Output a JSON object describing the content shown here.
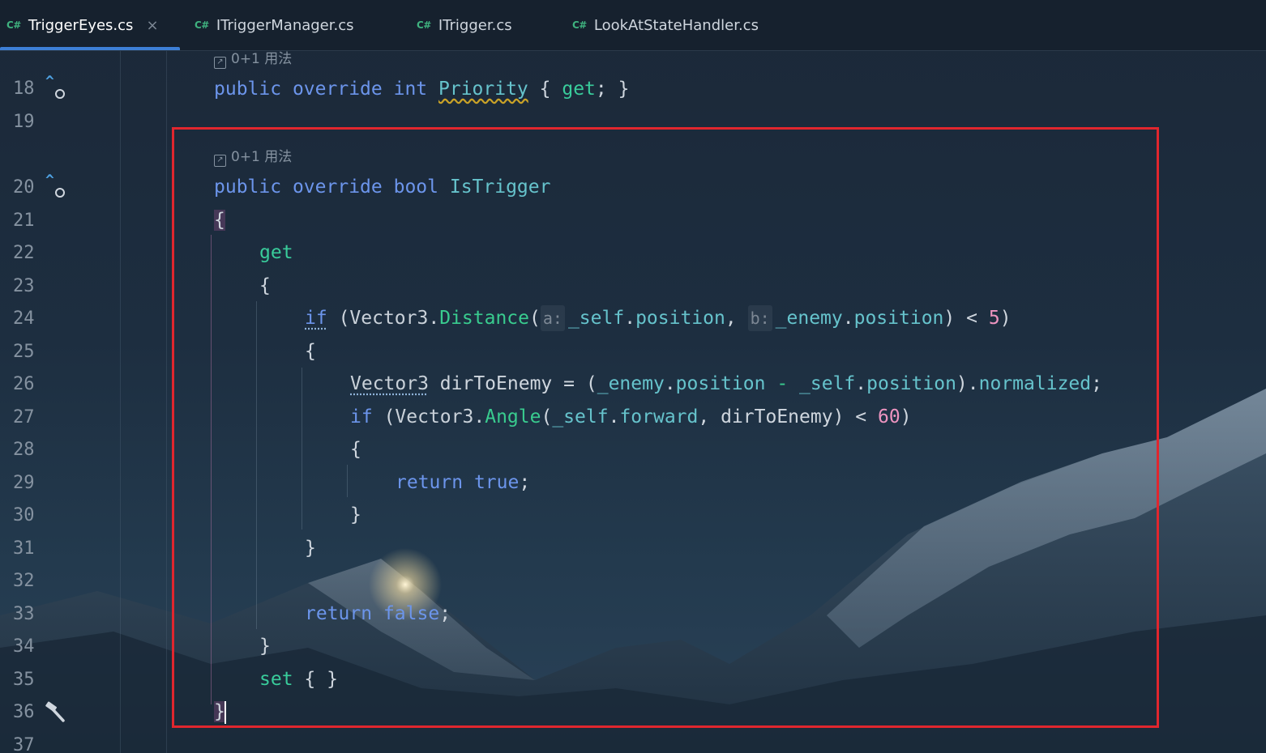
{
  "tabs": [
    {
      "lang": "C#",
      "name": "TriggerEyes.cs",
      "close": "×",
      "active": true
    },
    {
      "lang": "C#",
      "name": "ITriggerManager.cs",
      "active": false
    },
    {
      "lang": "C#",
      "name": "ITrigger.cs",
      "active": false
    },
    {
      "lang": "C#",
      "name": "LookAtStateHandler.cs",
      "active": false
    }
  ],
  "usage_hint": "0+1 用法",
  "line_numbers": [
    "18",
    "19",
    "20",
    "21",
    "22",
    "23",
    "24",
    "25",
    "26",
    "27",
    "28",
    "29",
    "30",
    "31",
    "32",
    "33",
    "34",
    "35",
    "36",
    "37"
  ],
  "code": {
    "l18": {
      "t1": "public",
      "t2": "override",
      "t3": "int",
      "t4": "Priority",
      "t5": "{",
      "t6": "get",
      "t7": ";",
      "t8": "}"
    },
    "l20": {
      "t1": "public",
      "t2": "override",
      "t3": "bool",
      "t4": "IsTrigger"
    },
    "open_brace": "{",
    "close_brace": "}",
    "get": "get",
    "l24": {
      "kw": "if",
      "p1": "(",
      "cls": "Vector3",
      "dot": ".",
      "meth": "Distance",
      "p2": "(",
      "hint_a": "a:",
      "self": "_self",
      "pos": "position",
      "comma": ",",
      "hint_b": "b:",
      "enemy": "_enemy",
      "pos2": "position",
      "p3": ")",
      "lt": "<",
      "num": "5",
      "p4": ")"
    },
    "l26": {
      "cls": "Vector3",
      "var": "dirToEnemy",
      "eq": "=",
      "p1": "(",
      "enemy": "_enemy",
      "pos": "position",
      "minus": "-",
      "self": "_self",
      "pos2": "position",
      "p2": ")",
      "norm": "normalized",
      "semi": ";"
    },
    "l27": {
      "kw": "if",
      "p1": "(",
      "cls": "Vector3",
      "meth": "Angle",
      "p2": "(",
      "self": "_self",
      "fwd": "forward",
      "comma": ",",
      "var": "dirToEnemy",
      "p3": ")",
      "lt": "<",
      "num": "60",
      "p4": ")"
    },
    "l29": {
      "kw": "return",
      "val": "true",
      "semi": ";"
    },
    "l33": {
      "kw": "return",
      "val": "false",
      "semi": ";"
    },
    "l35": {
      "kw": "set",
      "rest": "{ }"
    }
  }
}
